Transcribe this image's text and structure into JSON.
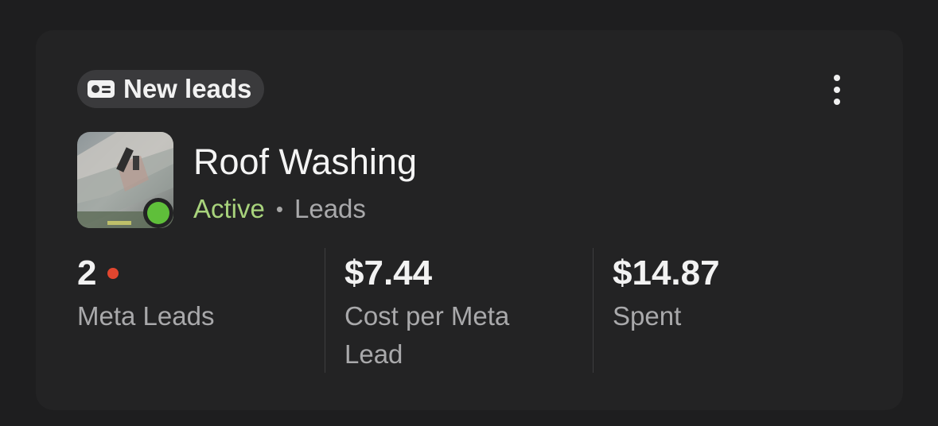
{
  "badge": {
    "label": "New leads",
    "icon": "lead-form-icon"
  },
  "menu": {
    "icon": "more-vertical-icon"
  },
  "campaign": {
    "name": "Roof Washing",
    "status": "Active",
    "separator": "•",
    "objective": "Leads",
    "status_color": "#5fbf3a"
  },
  "metrics": [
    {
      "value": "2",
      "label": "Meta Leads",
      "indicator_color": "#e2462f"
    },
    {
      "value": "$7.44",
      "label": "Cost per Meta Lead"
    },
    {
      "value": "$14.87",
      "label": "Spent"
    }
  ]
}
